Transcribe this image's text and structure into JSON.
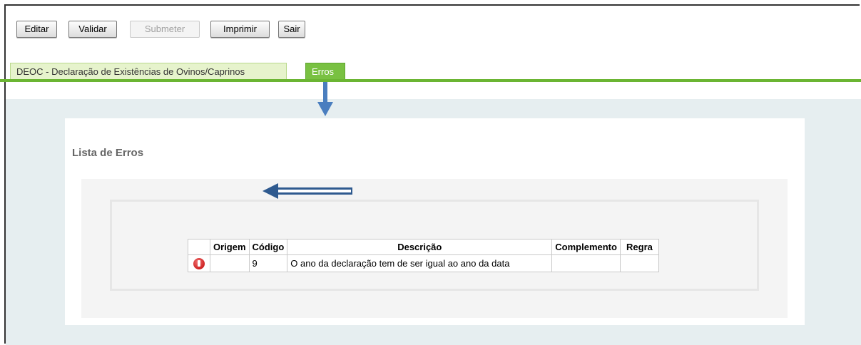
{
  "toolbar": {
    "edit_label": "Editar",
    "validate_label": "Validar",
    "submit_label": "Submeter",
    "print_label": "Imprimir",
    "exit_label": "Sair"
  },
  "tabs": [
    {
      "label": "DEOC - Declaração de Existências de Ovinos/Caprinos",
      "active": false
    },
    {
      "label": "Erros",
      "active": true
    }
  ],
  "errors_panel": {
    "title": "Lista de Erros",
    "columns": [
      "",
      "Origem",
      "Código",
      "Descrição",
      "Complemento",
      "Regra"
    ],
    "rows": [
      {
        "icon": "error-icon",
        "origem": "",
        "codigo": "9",
        "descricao": "O ano da declaração tem de ser igual ao ano da data",
        "complemento": "",
        "regra": ""
      }
    ]
  },
  "colors": {
    "tab_active": "#79c142",
    "tab_inactive": "#e6f3cc",
    "tab_line": "#6bb533",
    "content_bg": "#e6eef0",
    "annotation_arrow": "#4a7ebf",
    "error_icon": "#c00000"
  }
}
